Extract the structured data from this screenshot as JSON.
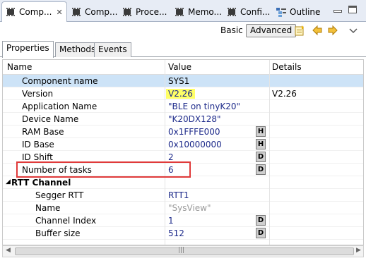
{
  "view_tabs": [
    {
      "label": "Comp...",
      "active": true
    },
    {
      "label": "Comp...",
      "active": false
    },
    {
      "label": "Proce...",
      "active": false
    },
    {
      "label": "Memo...",
      "active": false
    },
    {
      "label": "Confi...",
      "active": false
    },
    {
      "label": "Outline",
      "active": false
    }
  ],
  "close_glyph": "✕",
  "toolbar": {
    "basic_label": "Basic",
    "advanced_label": "Advanced"
  },
  "inner_tabs": [
    "Properties",
    "Methods",
    "Events"
  ],
  "columns": {
    "name": "Name",
    "value": "Value",
    "details": "Details"
  },
  "rows": [
    {
      "name": "Component name",
      "value": "SYS1",
      "selected": true
    },
    {
      "name": "Version",
      "value": "V2.26",
      "details": "V2.26",
      "highlight": true
    },
    {
      "name": "Application Name",
      "value": "\"BLE on tinyK20\""
    },
    {
      "name": "Device Name",
      "value": "\"K20DX128\""
    },
    {
      "name": "RAM Base",
      "value": "0x1FFFE000",
      "badge": "H"
    },
    {
      "name": "ID Base",
      "value": "0x10000000",
      "badge": "H"
    },
    {
      "name": "ID Shift",
      "value": "2",
      "badge": "D"
    },
    {
      "name": "Number of tasks",
      "value": "6",
      "badge": "D",
      "boxed": true
    },
    {
      "name": "RTT Channel",
      "group": true
    },
    {
      "name": "Segger RTT",
      "value": "RTT1"
    },
    {
      "name": "Name",
      "value": "\"SysView\"",
      "gray": true
    },
    {
      "name": "Channel Index",
      "value": "1",
      "badge": "D"
    },
    {
      "name": "Buffer size",
      "value": "512",
      "badge": "D"
    }
  ],
  "expander_glyph": "◢",
  "scroll_grip": "|||",
  "colors": {
    "selection": "#cde3f7",
    "highlight": "#ffff66",
    "annotation": "#e03a3a",
    "value_text": "#1d2a8a"
  }
}
